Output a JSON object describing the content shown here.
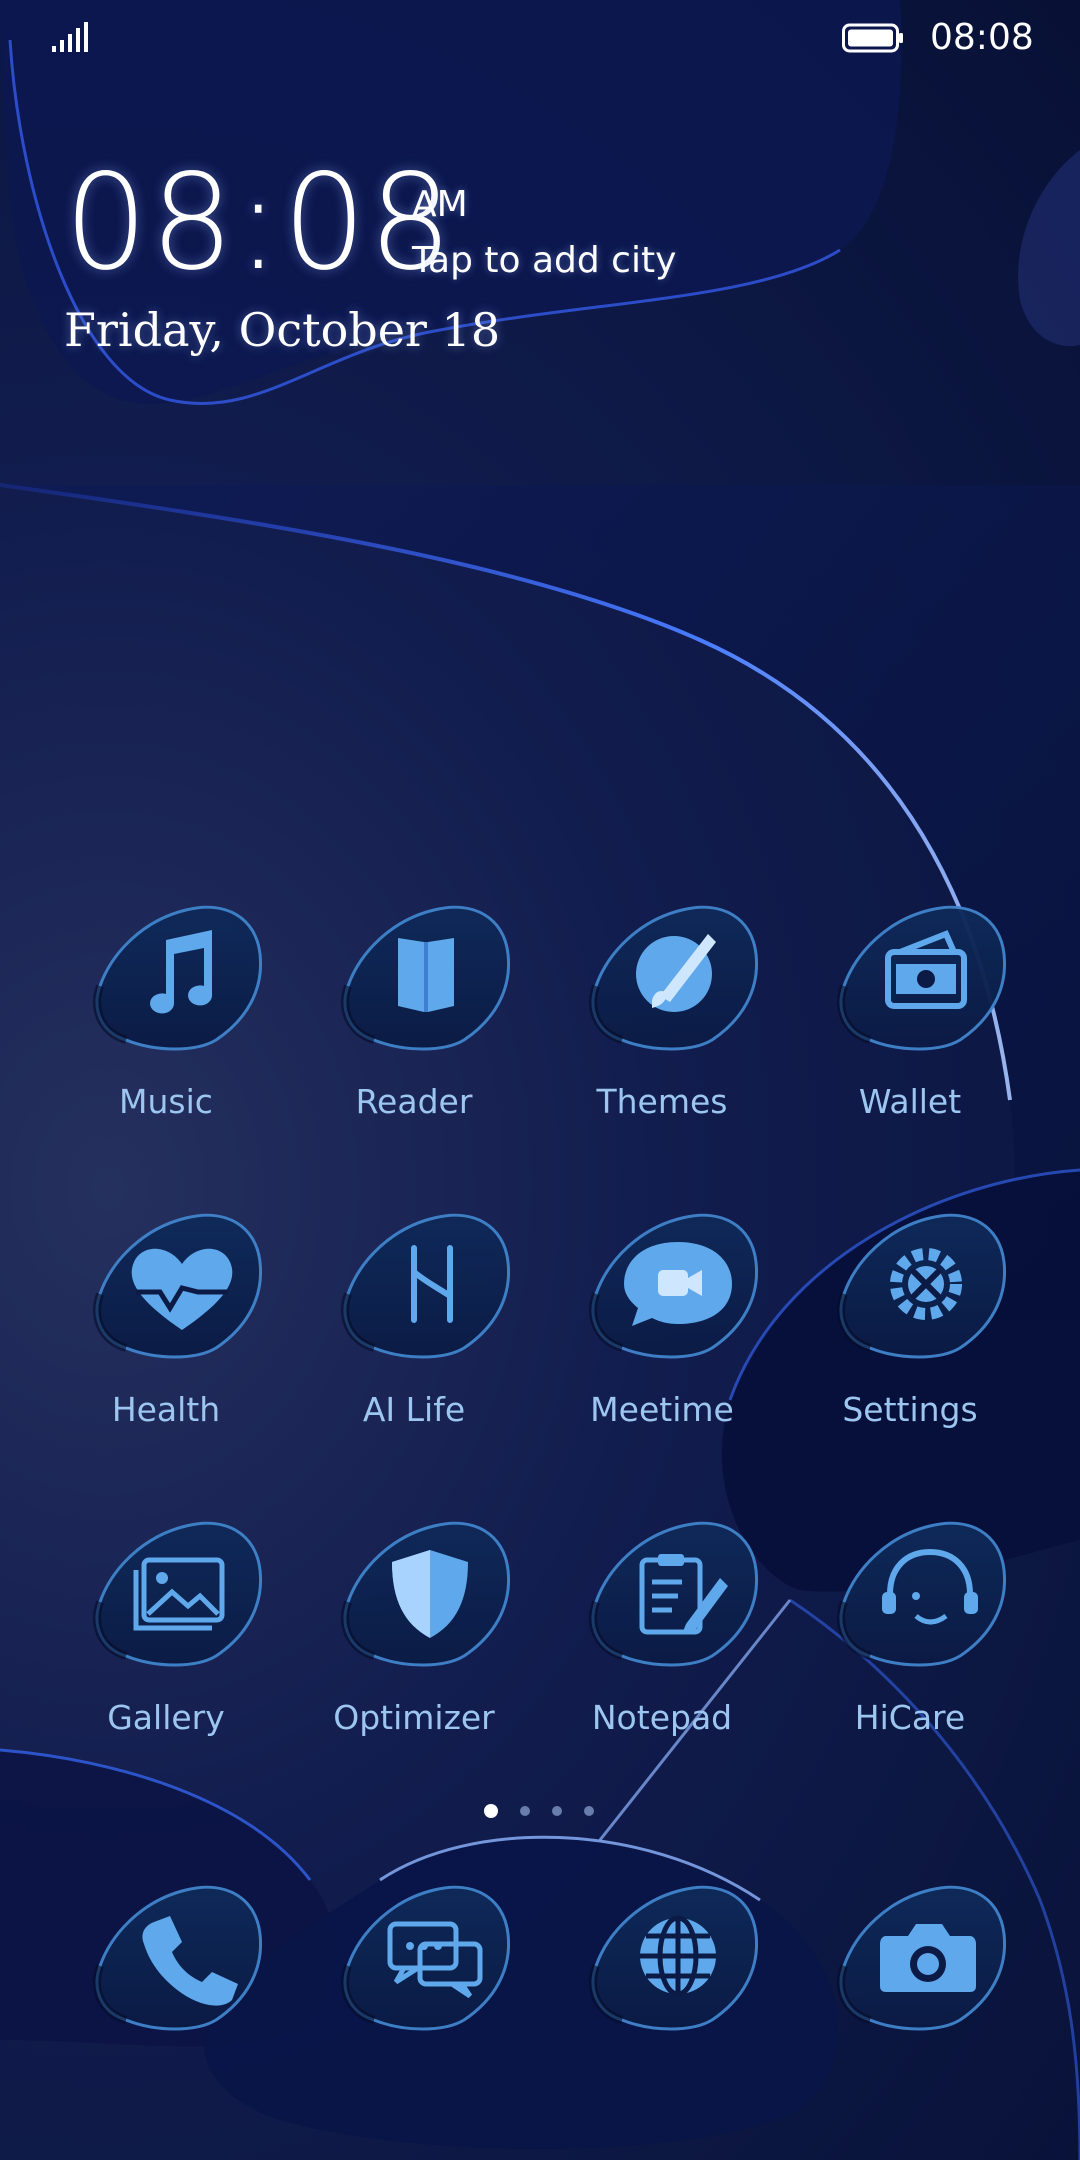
{
  "status_bar": {
    "time": "08:08",
    "signal_icon": "signal-icon",
    "battery_icon": "battery-icon"
  },
  "clock_widget": {
    "time": "08:08",
    "ampm": "AM",
    "city_prompt": "Tap to add city",
    "date": "Friday, October 18"
  },
  "apps": [
    {
      "label": "Music",
      "icon": "music-note-icon"
    },
    {
      "label": "Reader",
      "icon": "book-icon"
    },
    {
      "label": "Themes",
      "icon": "paintbrush-icon"
    },
    {
      "label": "Wallet",
      "icon": "wallet-icon"
    },
    {
      "label": "Health",
      "icon": "heart-icon"
    },
    {
      "label": "AI Life",
      "icon": "ai-life-icon"
    },
    {
      "label": "Meetime",
      "icon": "video-chat-icon"
    },
    {
      "label": "Settings",
      "icon": "gear-tools-icon"
    },
    {
      "label": "Gallery",
      "icon": "image-icon"
    },
    {
      "label": "Optimizer",
      "icon": "shield-icon"
    },
    {
      "label": "Notepad",
      "icon": "notepad-icon"
    },
    {
      "label": "HiCare",
      "icon": "headset-icon"
    }
  ],
  "page_indicator": {
    "count": 4,
    "active_index": 0
  },
  "dock": [
    {
      "icon": "phone-icon"
    },
    {
      "icon": "messages-icon"
    },
    {
      "icon": "browser-globe-icon"
    },
    {
      "icon": "camera-icon"
    }
  ],
  "colors": {
    "label": "#9cc6f0",
    "icon_fill": "#5fa8ec",
    "accent_glow": "#3a6cff"
  }
}
